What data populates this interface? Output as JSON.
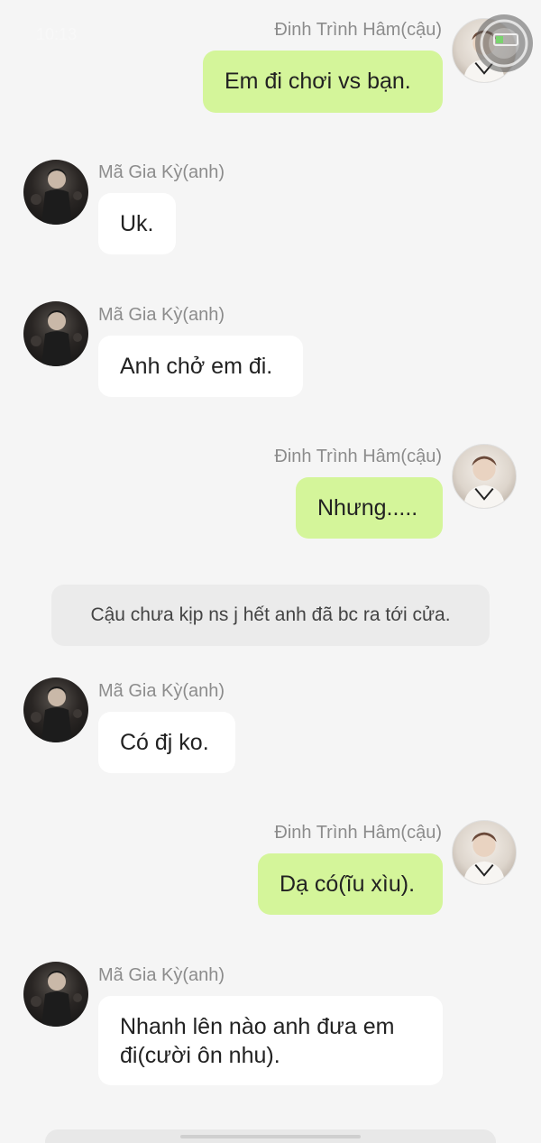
{
  "status": {
    "time": "10:13"
  },
  "characters": {
    "right": {
      "name": "Đinh Trình Hâm(cậu)"
    },
    "left": {
      "name": "Mã Gia Kỳ(anh)"
    }
  },
  "messages": [
    {
      "side": "right",
      "name": "Đinh Trình Hâm(cậu)",
      "text": "Em đi chơi vs bạn."
    },
    {
      "side": "left",
      "name": "Mã Gia Kỳ(anh)",
      "text": "Uk."
    },
    {
      "side": "left",
      "name": "Mã Gia Kỳ(anh)",
      "text": "Anh chở em đi."
    },
    {
      "side": "right",
      "name": "Đinh Trình Hâm(cậu)",
      "text": "Nhưng....."
    },
    {
      "side": "narration",
      "text": "Cậu chưa kịp ns j hết anh đã bc ra tới cửa."
    },
    {
      "side": "left",
      "name": "Mã Gia Kỳ(anh)",
      "text": "Có đj ko."
    },
    {
      "side": "right",
      "name": "Đinh Trình Hâm(cậu)",
      "text": "Dạ có(ĩu xìu)."
    },
    {
      "side": "left",
      "name": "Mã Gia Kỳ(anh)",
      "text_line1": "Nhanh lên nào anh đưa em",
      "text_line2": "đi(cười ôn nhu)."
    }
  ],
  "colors": {
    "green_bubble": "#d4f59a",
    "white_bubble": "#ffffff",
    "background": "#f5f5f5"
  }
}
